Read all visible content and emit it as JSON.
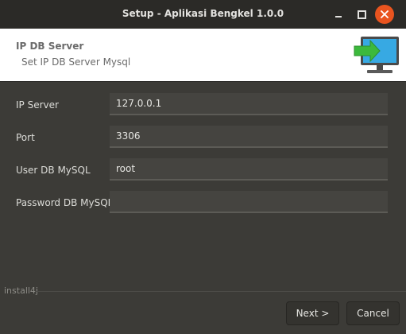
{
  "window": {
    "title": "Setup - Aplikasi Bengkel 1.0.0"
  },
  "header": {
    "title": "IP DB Server",
    "subtitle": "Set IP DB Server Mysql",
    "icon": "monitor-arrow-icon"
  },
  "form": {
    "fields": [
      {
        "label": "IP Server",
        "value": "127.0.0.1"
      },
      {
        "label": "Port",
        "value": "3306"
      },
      {
        "label": "User DB MySQL",
        "value": "root"
      },
      {
        "label": "Password DB MySQL",
        "value": ""
      }
    ]
  },
  "footer": {
    "brand": "install4j",
    "next_label": "Next >",
    "cancel_label": "Cancel"
  },
  "colors": {
    "close_button": "#e9541f",
    "background": "#3c3b37",
    "banner": "#ffffff",
    "arrow": "#3cb93c",
    "monitor_screen": "#37a9e3"
  }
}
